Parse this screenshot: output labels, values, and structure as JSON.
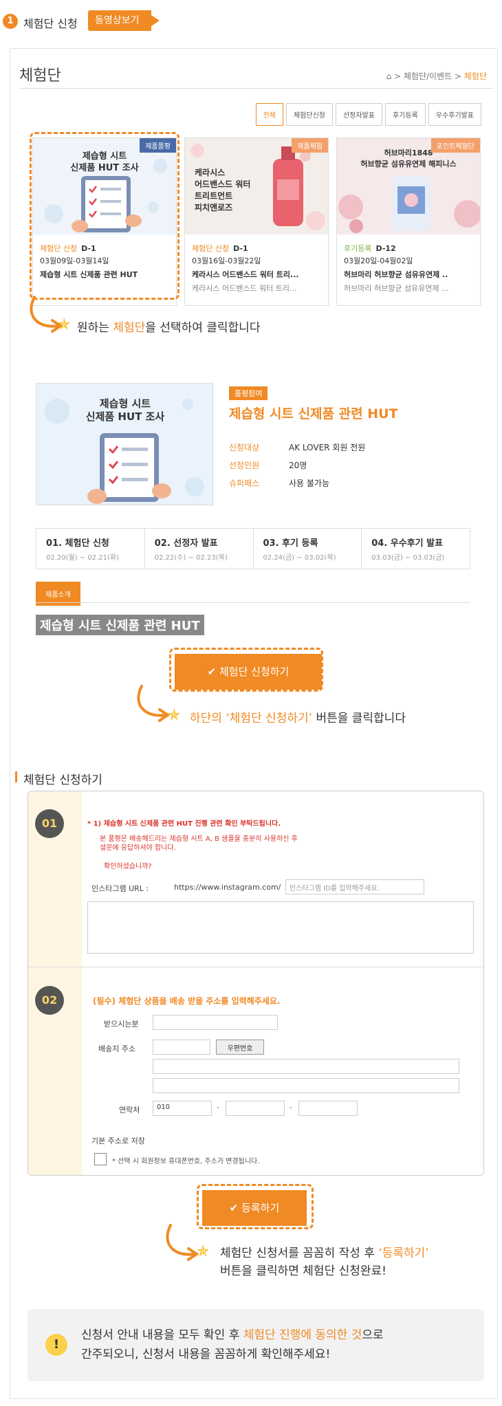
{
  "step": {
    "number": "1",
    "title": "체험단 신청",
    "video_button": "동영상보기"
  },
  "page": {
    "title": "체험단",
    "breadcrumb_mid": "> 체험단/이벤트 >",
    "breadcrumb_current": "체험단"
  },
  "tabs": [
    "전체",
    "체험단신청",
    "선정자발표",
    "후기등록",
    "우수후기발표"
  ],
  "cards": [
    {
      "badge": "제품품평",
      "img_title": "제습형 시트\n신제품 HUT 조사",
      "status": "체험단 신청",
      "dday": "D-1",
      "date": "03월09일-03월14일",
      "name": "제습형 시트 신제품 관련 HUT",
      "sub": ""
    },
    {
      "badge": "제품체험",
      "img_title": "케라시스\n어드밴스드 워터\n트리트먼트\n피치앤로즈",
      "status": "체험단 신청",
      "dday": "D-1",
      "date": "03월16일-03월22일",
      "name": "케라시스 어드밴스드 워터 트리...",
      "sub": "케라시스 어드밴스드 워터 트리..."
    },
    {
      "badge": "포인트체험단",
      "img_title": "허브마리1848\n허브향균 섬유유연제 해피니스",
      "status": "후기등록",
      "dday": "D-12",
      "date": "03월20일-04월02일",
      "name": "허브마리 허브향균 섬유유연제 ..",
      "sub": "허브마리 허브향균 섬유유연제 ..."
    }
  ],
  "hint1": {
    "pre": "원하는",
    "highlight": "체험단",
    "post": "을 선택하여 클릭합니다"
  },
  "detail": {
    "img_title": "제습형 시트\n신제품 HUT 조사",
    "badge": "품평참여",
    "title": "제습형 시트 신제품 관련 HUT",
    "rows": [
      {
        "label": "신청대상",
        "value": "AK LOVER 회원 전원"
      },
      {
        "label": "선정인원",
        "value": "20명"
      },
      {
        "label": "슈퍼패스",
        "value": "사용 불가능"
      }
    ]
  },
  "timeline": [
    {
      "title": "01. 체험단 신청",
      "date": "02.20(월) ~ 02.21(화)"
    },
    {
      "title": "02. 선정자 발표",
      "date": "02.22(수) ~ 02.23(목)"
    },
    {
      "title": "03. 후기 등록",
      "date": "02.24(금) ~ 03.02(목)"
    },
    {
      "title": "04. 우수후기 발표",
      "date": "03.03(금) ~ 03.03(금)"
    }
  ],
  "intro_tab": "제품소개",
  "product_heading": "제습형 시트 신제품 관련 HUT",
  "apply_button": "체험단 신청하기",
  "hint2": {
    "pre": "하단의",
    "highlight": "‘체험단 신청하기’",
    "post": "버튼을 클릭합니다"
  },
  "form": {
    "section_title": "체험단 신청하기",
    "q1_num": "01",
    "q1_title": "* 1) 제습형 시트 신제품 관련 HUT 진행 관련 확인 부탁드립니다.",
    "q1_note1": "본 품평은 배송해드리는 제습형 시트 A, B 샘플을 충분히 사용하신 후",
    "q1_note2": "설문에 응답하셔야 합니다.",
    "q1_note3": "확인하셨습니까?",
    "insta_label": "인스타그램 URL :",
    "insta_prefix": "https://www.instagram.com/",
    "insta_placeholder": "인스타그램 ID를 입력해주세요.",
    "q2_num": "02",
    "q2_title": "(필수) 체험단 상품을 배송 받을 주소를 입력해주세요.",
    "recipient_label": "받으시는분",
    "address_label": "배송지 주소",
    "zip_button": "우편번호",
    "phone_label": "연락처",
    "phone_prefix": "010",
    "dash": "-",
    "save_label": "기본 주소로 저장",
    "save_note": "* 선택 시 회원정보 휴대폰번호, 주소가 변경됩니다."
  },
  "register_button": "등록하기",
  "hint3": {
    "pre": "체험단 신청서를 꼼꼼히 작성 후",
    "highlight": "‘등록하기’",
    "line2": "버튼을 클릭하면 체험단 신청완료!"
  },
  "notice": {
    "line1_pre": "신청서 안내 내용을 모두 확인 후",
    "line1_highlight": "체험단 진행에 동의한 것",
    "line1_post": "으로",
    "line2": "간주되오니, 신청서 내용을 꼼꼼하게 확인해주세요!"
  }
}
